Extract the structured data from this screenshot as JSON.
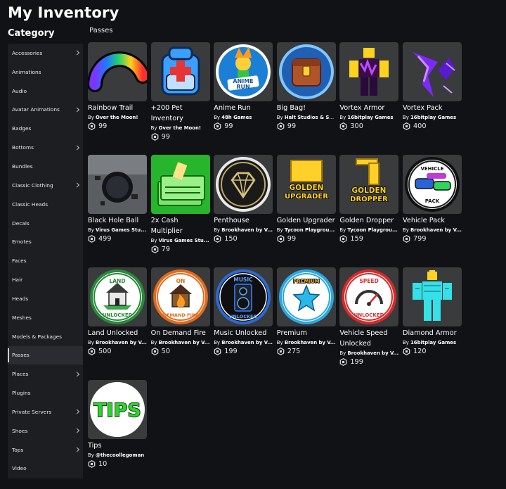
{
  "page_title": "My Inventory",
  "category_heading": "Category",
  "section_label": "Passes",
  "creator_prefix": "By",
  "sidebar": [
    {
      "label": "Accessories",
      "chevron": true
    },
    {
      "label": "Animations",
      "chevron": false
    },
    {
      "label": "Audio",
      "chevron": false
    },
    {
      "label": "Avatar Animations",
      "chevron": true
    },
    {
      "label": "Badges",
      "chevron": false
    },
    {
      "label": "Bottoms",
      "chevron": true
    },
    {
      "label": "Bundles",
      "chevron": false
    },
    {
      "label": "Classic Clothing",
      "chevron": true
    },
    {
      "label": "Classic Heads",
      "chevron": false
    },
    {
      "label": "Decals",
      "chevron": false
    },
    {
      "label": "Emotes",
      "chevron": false
    },
    {
      "label": "Faces",
      "chevron": false
    },
    {
      "label": "Hair",
      "chevron": false
    },
    {
      "label": "Heads",
      "chevron": false
    },
    {
      "label": "Meshes",
      "chevron": false
    },
    {
      "label": "Models & Packages",
      "chevron": false
    },
    {
      "label": "Passes",
      "chevron": false,
      "active": true
    },
    {
      "label": "Places",
      "chevron": true
    },
    {
      "label": "Plugins",
      "chevron": false
    },
    {
      "label": "Private Servers",
      "chevron": true
    },
    {
      "label": "Shoes",
      "chevron": true
    },
    {
      "label": "Tops",
      "chevron": true
    },
    {
      "label": "Video",
      "chevron": false
    }
  ],
  "items": [
    {
      "name": "Rainbow Trail",
      "creator": "Over the Moon!",
      "price": "99",
      "icon": "rainbow-trail-icon"
    },
    {
      "name": "+200 Pet Inventory",
      "creator": "Over the Moon!",
      "price": "99",
      "icon": "backpack-icon"
    },
    {
      "name": "Anime Run",
      "creator": "48h Games",
      "price": "99",
      "icon": "anime-run-icon"
    },
    {
      "name": "Big Bag!",
      "creator": "Halt Studios & Sp...",
      "price": "99",
      "icon": "big-bag-icon"
    },
    {
      "name": "Vortex Armor",
      "creator": "16bitplay Games",
      "price": "300",
      "icon": "vortex-armor-icon"
    },
    {
      "name": "Vortex Pack",
      "creator": "16bitplay Games",
      "price": "400",
      "icon": "vortex-pack-icon"
    },
    {
      "name": "Black Hole Ball",
      "creator": "Virus Games Stu...",
      "price": "499",
      "icon": "black-hole-icon"
    },
    {
      "name": "2x Cash Multiplier",
      "creator": "Virus Games Stu...",
      "price": "79",
      "icon": "cash-icon"
    },
    {
      "name": "Penthouse",
      "creator": "Brookhaven by V...",
      "price": "150",
      "icon": "diamond-icon"
    },
    {
      "name": "Golden Upgrader",
      "creator": "Tycoon Playgrou...",
      "price": "99",
      "icon": "golden-upgrader-icon",
      "badge_text": [
        "GOLDEN",
        "UPGRADER"
      ]
    },
    {
      "name": "Golden Dropper",
      "creator": "Tycoon Playgrou...",
      "price": "159",
      "icon": "golden-dropper-icon",
      "badge_text": [
        "GOLDEN",
        "DROPPER"
      ]
    },
    {
      "name": "Vehicle Pack",
      "creator": "Brookhaven by V...",
      "price": "799",
      "icon": "vehicle-pack-icon",
      "badge_text": [
        "VEHICLE",
        "PACK"
      ]
    },
    {
      "name": "Land Unlocked",
      "creator": "Brookhaven by V...",
      "price": "500",
      "icon": "land-icon",
      "badge_text": [
        "LAND",
        "UNLOCKED"
      ]
    },
    {
      "name": "On Demand Fire",
      "creator": "Brookhaven by V...",
      "price": "50",
      "icon": "fire-house-icon",
      "badge_text": [
        "ON",
        "DEMAND FIRE"
      ]
    },
    {
      "name": "Music Unlocked",
      "creator": "Brookhaven by V...",
      "price": "199",
      "icon": "speaker-icon",
      "badge_text": [
        "MUSIC",
        "UNLOCKED"
      ]
    },
    {
      "name": "Premium",
      "creator": "Brookhaven by V...",
      "price": "275",
      "icon": "star-icon",
      "badge_text": [
        "PREMIUM"
      ]
    },
    {
      "name": "Vehicle Speed Unlocked",
      "creator": "Brookhaven by V...",
      "price": "199",
      "icon": "speedometer-icon",
      "badge_text": [
        "SPEED",
        "UNLOCKED"
      ]
    },
    {
      "name": "Diamond Armor",
      "creator": "16bitplay Games",
      "price": "120",
      "icon": "diamond-armor-icon"
    },
    {
      "name": "Tips",
      "creator": "@thecoollegoman",
      "price": "10",
      "icon": "tips-icon",
      "badge_text": [
        "TIPS"
      ]
    }
  ],
  "colors": {
    "background": "#111216",
    "sidebar": "#1d1e22",
    "thumb": "#393b3d"
  }
}
